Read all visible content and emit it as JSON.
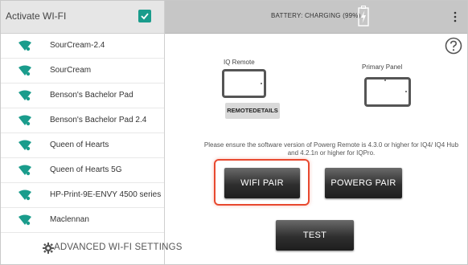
{
  "left": {
    "title": "Activate WI-FI",
    "checkbox_checked": true,
    "networks": [
      {
        "ssid": "SourCream-2.4"
      },
      {
        "ssid": "SourCream"
      },
      {
        "ssid": "Benson's Bachelor Pad"
      },
      {
        "ssid": "Benson's Bachelor Pad 2.4"
      },
      {
        "ssid": "Queen of Hearts"
      },
      {
        "ssid": "Queen of Hearts 5G"
      },
      {
        "ssid": "HP-Print-9E-ENVY 4500 series"
      },
      {
        "ssid": "Maclennan"
      }
    ],
    "advanced_label": "ADVANCED WI-FI SETTINGS"
  },
  "topbar": {
    "battery_text": "BATTERY: CHARGING (99%)"
  },
  "devices": {
    "remote_label": "IQ Remote",
    "panel_label": "Primary Panel",
    "remote_details_button": "REMOTEDETAILS"
  },
  "notice": "Please ensure the software version of Powerg Remote is 4.3.0 or higher for IQ4/ IQ4 Hub and 4.2.1n or higher for IQPro.",
  "buttons": {
    "wifi_pair": "WIFI PAIR",
    "powerg_pair": "POWERG PAIR",
    "test": "TEST"
  },
  "colors": {
    "accent": "#1a9c8c",
    "highlight": "#e8492f",
    "topbar": "#c6c6c6"
  },
  "icons": {
    "wifi": "wifi-icon",
    "gear": "gear-icon",
    "battery": "battery-charging-icon",
    "menu": "more-vert-icon",
    "help": "help-icon",
    "checkbox": "checkbox-checked-icon"
  }
}
